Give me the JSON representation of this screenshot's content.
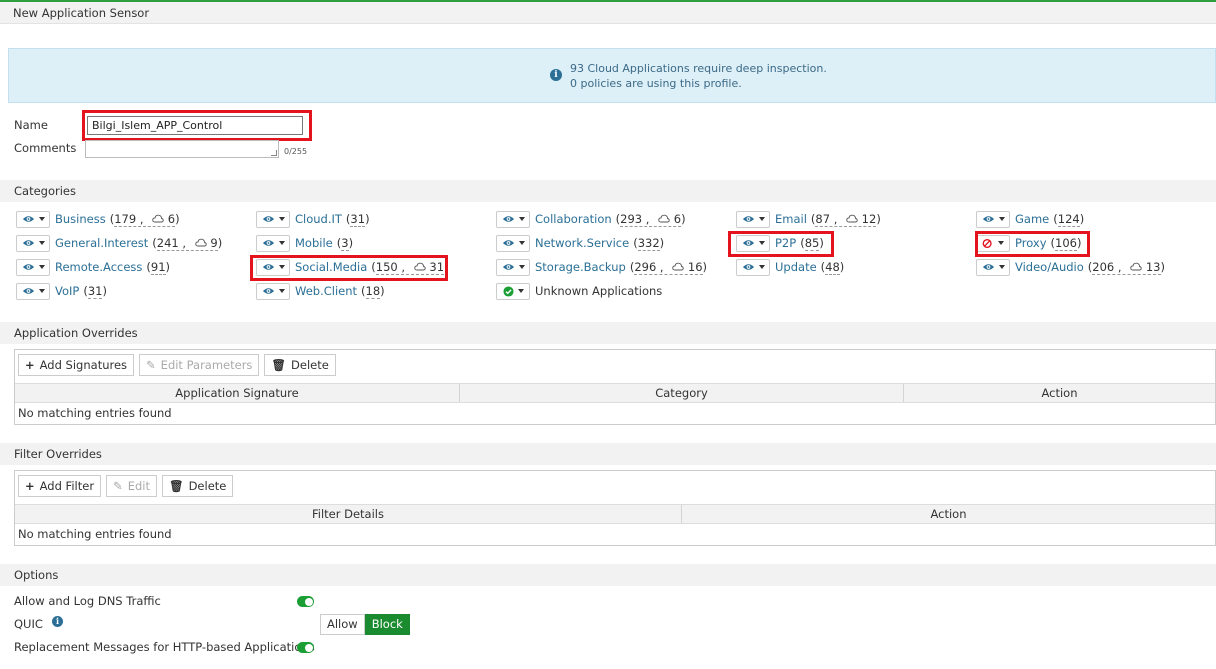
{
  "title": "New Application Sensor",
  "info": {
    "line1": "93 Cloud Applications require deep inspection.",
    "line2": "0 policies are using this profile."
  },
  "form": {
    "name_label": "Name",
    "name_value": "Bilgi_Islem_APP_Control",
    "comments_label": "Comments",
    "comments_count": "0/255"
  },
  "categories": {
    "header": "Categories",
    "items": [
      {
        "name": "Business",
        "count": "179",
        "cloud": "6",
        "action": "monitor"
      },
      {
        "name": "Cloud.IT",
        "count": "31",
        "action": "monitor"
      },
      {
        "name": "Collaboration",
        "count": "293",
        "cloud": "6",
        "action": "monitor"
      },
      {
        "name": "Email",
        "count": "87",
        "cloud": "12",
        "action": "monitor"
      },
      {
        "name": "Game",
        "count": "124",
        "action": "monitor"
      },
      {
        "name": "General.Interest",
        "count": "241",
        "cloud": "9",
        "action": "monitor"
      },
      {
        "name": "Mobile",
        "count": "3",
        "action": "monitor"
      },
      {
        "name": "Network.Service",
        "count": "332",
        "action": "monitor"
      },
      {
        "name": "P2P",
        "count": "85",
        "action": "monitor"
      },
      {
        "name": "Proxy",
        "count": "106",
        "action": "block"
      },
      {
        "name": "Remote.Access",
        "count": "91",
        "action": "monitor"
      },
      {
        "name": "Social.Media",
        "count": "150",
        "cloud": "31",
        "action": "monitor"
      },
      {
        "name": "Storage.Backup",
        "count": "296",
        "cloud": "16",
        "action": "monitor"
      },
      {
        "name": "Update",
        "count": "48",
        "action": "monitor"
      },
      {
        "name": "Video/Audio",
        "count": "206",
        "cloud": "13",
        "action": "monitor"
      },
      {
        "name": "VoIP",
        "count": "31",
        "action": "monitor"
      },
      {
        "name": "Web.Client",
        "count": "18",
        "action": "monitor"
      },
      {
        "name": "Unknown Applications",
        "action": "allow"
      }
    ]
  },
  "app_overrides": {
    "header": "Application Overrides",
    "add_label": "Add Signatures",
    "edit_label": "Edit Parameters",
    "delete_label": "Delete",
    "columns": [
      "Application Signature",
      "Category",
      "Action"
    ],
    "empty": "No matching entries found"
  },
  "filter_overrides": {
    "header": "Filter Overrides",
    "add_label": "Add Filter",
    "edit_label": "Edit",
    "delete_label": "Delete",
    "columns": [
      "Filter Details",
      "Action"
    ],
    "empty": "No matching entries found"
  },
  "options": {
    "header": "Options",
    "dns_label": "Allow and Log DNS Traffic",
    "dns_enabled": true,
    "quic_label": "QUIC",
    "quic_allow": "Allow",
    "quic_block": "Block",
    "quic_selected": "Block",
    "replacement_label": "Replacement Messages for HTTP-based Applications",
    "replacement_enabled": true
  },
  "colors": {
    "link": "#2b6f96",
    "highlight": "#e3141e",
    "toggle_on": "#1b9e34",
    "block_active": "#1a8b2e"
  }
}
